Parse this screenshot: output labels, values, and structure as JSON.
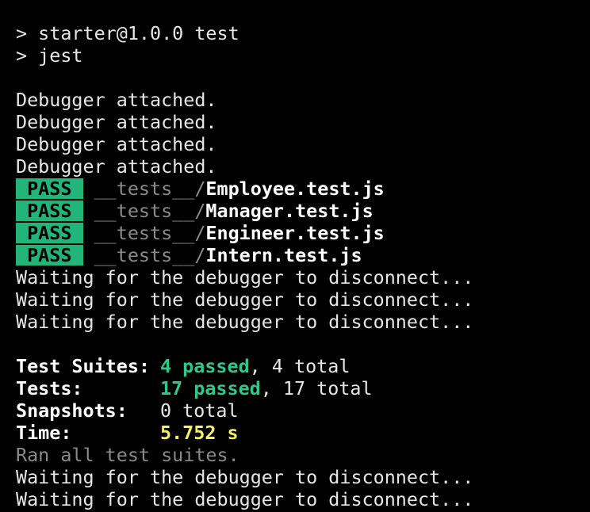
{
  "terminal": {
    "header": [
      "> starter@1.0.0 test",
      "> jest"
    ],
    "debugger_lines": [
      "Debugger attached.",
      "Debugger attached.",
      "Debugger attached.",
      "Debugger attached."
    ],
    "pass_label": " PASS ",
    "test_dir": "__tests__/",
    "tests": [
      {
        "status": "PASS",
        "file": "Employee.test.js"
      },
      {
        "status": "PASS",
        "file": "Manager.test.js"
      },
      {
        "status": "PASS",
        "file": "Engineer.test.js"
      },
      {
        "status": "PASS",
        "file": "Intern.test.js"
      }
    ],
    "waiting_lines_1": [
      "Waiting for the debugger to disconnect...",
      "Waiting for the debugger to disconnect...",
      "Waiting for the debugger to disconnect..."
    ],
    "summary": {
      "suites_label": "Test Suites:",
      "suites_passed": "4 passed",
      "suites_total": ", 4 total",
      "tests_label": "Tests:",
      "tests_passed": "17 passed",
      "tests_total": ", 17 total",
      "snapshots_label": "Snapshots:",
      "snapshots_value": "0 total",
      "time_label": "Time:",
      "time_value": "5.752 s"
    },
    "ran_all": "Ran all test suites.",
    "waiting_lines_2": [
      "Waiting for the debugger to disconnect...",
      "Waiting for the debugger to disconnect..."
    ],
    "colors": {
      "background": "#000000",
      "pass_badge": "#21b57a",
      "passed_text": "#2ec98a",
      "time_text": "#f5f062",
      "dim_text": "#8a8a8a"
    }
  }
}
